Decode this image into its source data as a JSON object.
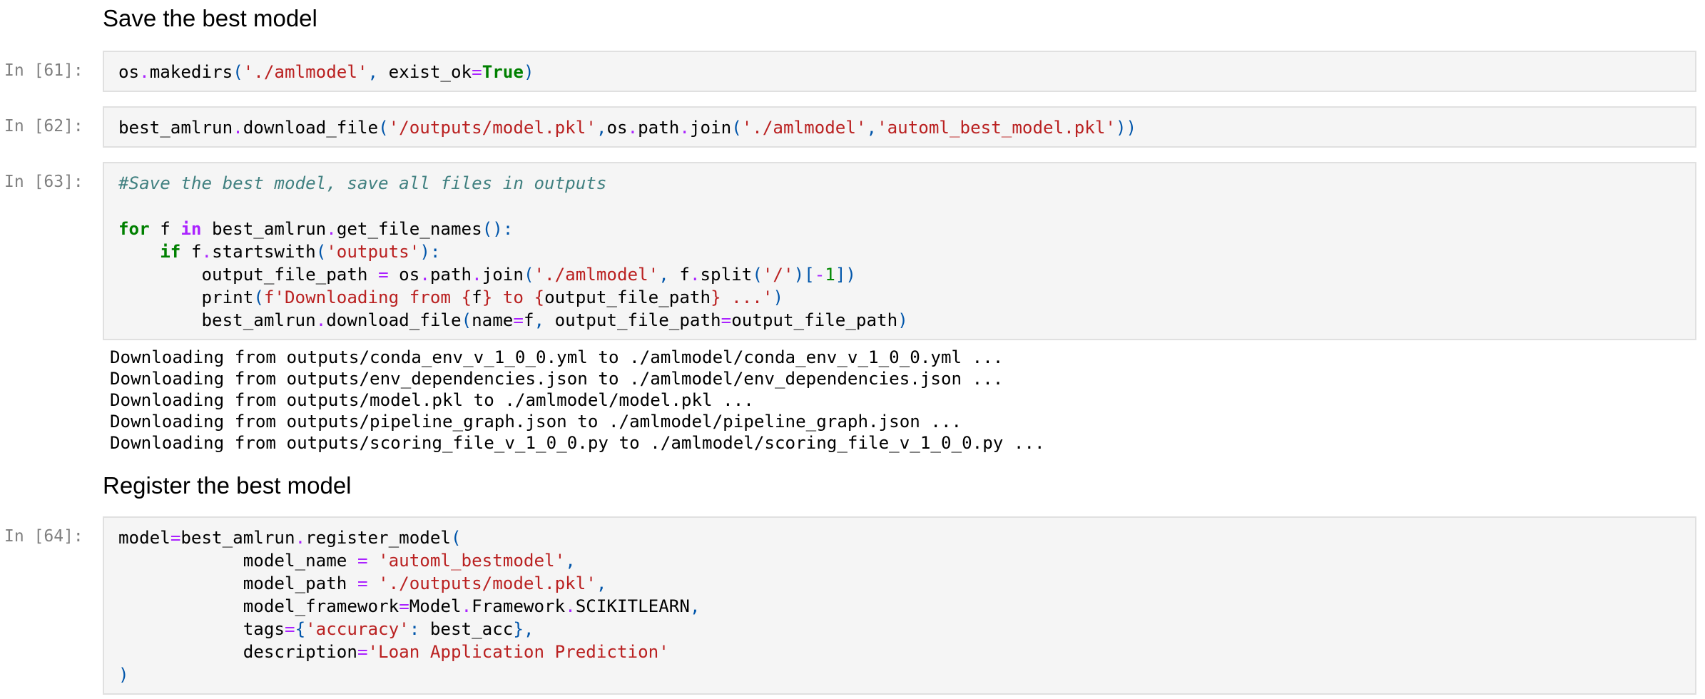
{
  "headings": {
    "save": "Save the best model",
    "register": "Register the best model"
  },
  "cells": [
    {
      "prompt": "In [61]:",
      "lines": [
        [
          [
            "t",
            "os"
          ],
          [
            "o",
            "."
          ],
          [
            "t",
            "makedirs"
          ],
          [
            "p",
            "("
          ],
          [
            "s",
            "'./amlmodel'"
          ],
          [
            "p",
            ","
          ],
          [
            "t",
            " exist_ok"
          ],
          [
            "o",
            "="
          ],
          [
            "k",
            "True"
          ],
          [
            "p",
            ")"
          ]
        ]
      ]
    },
    {
      "prompt": "In [62]:",
      "lines": [
        [
          [
            "t",
            "best_amlrun"
          ],
          [
            "o",
            "."
          ],
          [
            "t",
            "download_file"
          ],
          [
            "p",
            "("
          ],
          [
            "s",
            "'/outputs/model.pkl'"
          ],
          [
            "p",
            ","
          ],
          [
            "t",
            "os"
          ],
          [
            "o",
            "."
          ],
          [
            "t",
            "path"
          ],
          [
            "o",
            "."
          ],
          [
            "t",
            "join"
          ],
          [
            "p",
            "("
          ],
          [
            "s",
            "'./amlmodel'"
          ],
          [
            "p",
            ","
          ],
          [
            "s",
            "'automl_best_model.pkl'"
          ],
          [
            "p",
            "))"
          ]
        ]
      ]
    },
    {
      "prompt": "In [63]:",
      "lines": [
        [
          [
            "c",
            "#Save the best model, save all files in outputs"
          ]
        ],
        [],
        [
          [
            "k",
            "for"
          ],
          [
            "t",
            " f "
          ],
          [
            "w",
            "in"
          ],
          [
            "t",
            " best_amlrun"
          ],
          [
            "o",
            "."
          ],
          [
            "t",
            "get_file_names"
          ],
          [
            "p",
            "():"
          ]
        ],
        [
          [
            "t",
            "    "
          ],
          [
            "k",
            "if"
          ],
          [
            "t",
            " f"
          ],
          [
            "o",
            "."
          ],
          [
            "t",
            "startswith"
          ],
          [
            "p",
            "("
          ],
          [
            "s",
            "'outputs'"
          ],
          [
            "p",
            "):"
          ]
        ],
        [
          [
            "t",
            "        output_file_path "
          ],
          [
            "o",
            "="
          ],
          [
            "t",
            " os"
          ],
          [
            "o",
            "."
          ],
          [
            "t",
            "path"
          ],
          [
            "o",
            "."
          ],
          [
            "t",
            "join"
          ],
          [
            "p",
            "("
          ],
          [
            "s",
            "'./amlmodel'"
          ],
          [
            "p",
            ","
          ],
          [
            "t",
            " f"
          ],
          [
            "o",
            "."
          ],
          [
            "t",
            "split"
          ],
          [
            "p",
            "("
          ],
          [
            "s",
            "'/'"
          ],
          [
            "p",
            ")["
          ],
          [
            "o",
            "-"
          ],
          [
            "n",
            "1"
          ],
          [
            "p",
            "])"
          ]
        ],
        [
          [
            "t",
            "        print"
          ],
          [
            "p",
            "("
          ],
          [
            "s",
            "f'Downloading from {"
          ],
          [
            "t",
            "f"
          ],
          [
            "s",
            "} to {"
          ],
          [
            "t",
            "output_file_path"
          ],
          [
            "s",
            "} ...'"
          ],
          [
            "p",
            ")"
          ]
        ],
        [
          [
            "t",
            "        best_amlrun"
          ],
          [
            "o",
            "."
          ],
          [
            "t",
            "download_file"
          ],
          [
            "p",
            "("
          ],
          [
            "t",
            "name"
          ],
          [
            "o",
            "="
          ],
          [
            "t",
            "f"
          ],
          [
            "p",
            ","
          ],
          [
            "t",
            " output_file_path"
          ],
          [
            "o",
            "="
          ],
          [
            "t",
            "output_file_path"
          ],
          [
            "p",
            ")"
          ]
        ]
      ]
    },
    {
      "prompt": "In [64]:",
      "lines": [
        [
          [
            "t",
            "model"
          ],
          [
            "o",
            "="
          ],
          [
            "t",
            "best_amlrun"
          ],
          [
            "o",
            "."
          ],
          [
            "t",
            "register_model"
          ],
          [
            "p",
            "("
          ]
        ],
        [
          [
            "t",
            "            model_name "
          ],
          [
            "o",
            "="
          ],
          [
            "t",
            " "
          ],
          [
            "s",
            "'automl_bestmodel'"
          ],
          [
            "p",
            ","
          ]
        ],
        [
          [
            "t",
            "            model_path "
          ],
          [
            "o",
            "="
          ],
          [
            "t",
            " "
          ],
          [
            "s",
            "'./outputs/model.pkl'"
          ],
          [
            "p",
            ","
          ]
        ],
        [
          [
            "t",
            "            model_framework"
          ],
          [
            "o",
            "="
          ],
          [
            "t",
            "Model"
          ],
          [
            "o",
            "."
          ],
          [
            "t",
            "Framework"
          ],
          [
            "o",
            "."
          ],
          [
            "t",
            "SCIKITLEARN"
          ],
          [
            "p",
            ","
          ]
        ],
        [
          [
            "t",
            "            tags"
          ],
          [
            "o",
            "="
          ],
          [
            "p",
            "{"
          ],
          [
            "s",
            "'accuracy'"
          ],
          [
            "p",
            ":"
          ],
          [
            "t",
            " best_acc"
          ],
          [
            "p",
            "},"
          ]
        ],
        [
          [
            "t",
            "            description"
          ],
          [
            "o",
            "="
          ],
          [
            "s",
            "'Loan Application Prediction'"
          ]
        ],
        [
          [
            "p",
            ")"
          ]
        ]
      ]
    }
  ],
  "output_63": [
    "Downloading from outputs/conda_env_v_1_0_0.yml to ./amlmodel/conda_env_v_1_0_0.yml ...",
    "Downloading from outputs/env_dependencies.json to ./amlmodel/env_dependencies.json ...",
    "Downloading from outputs/model.pkl to ./amlmodel/model.pkl ...",
    "Downloading from outputs/pipeline_graph.json to ./amlmodel/pipeline_graph.json ...",
    "Downloading from outputs/scoring_file_v_1_0_0.py to ./amlmodel/scoring_file_v_1_0_0.py ..."
  ],
  "colors": {
    "keyword": "#008000",
    "operator": "#aa22ff",
    "string": "#ba2121",
    "comment": "#408080",
    "cell_bg": "#f5f5f5",
    "prompt": "#7f7f7f"
  }
}
